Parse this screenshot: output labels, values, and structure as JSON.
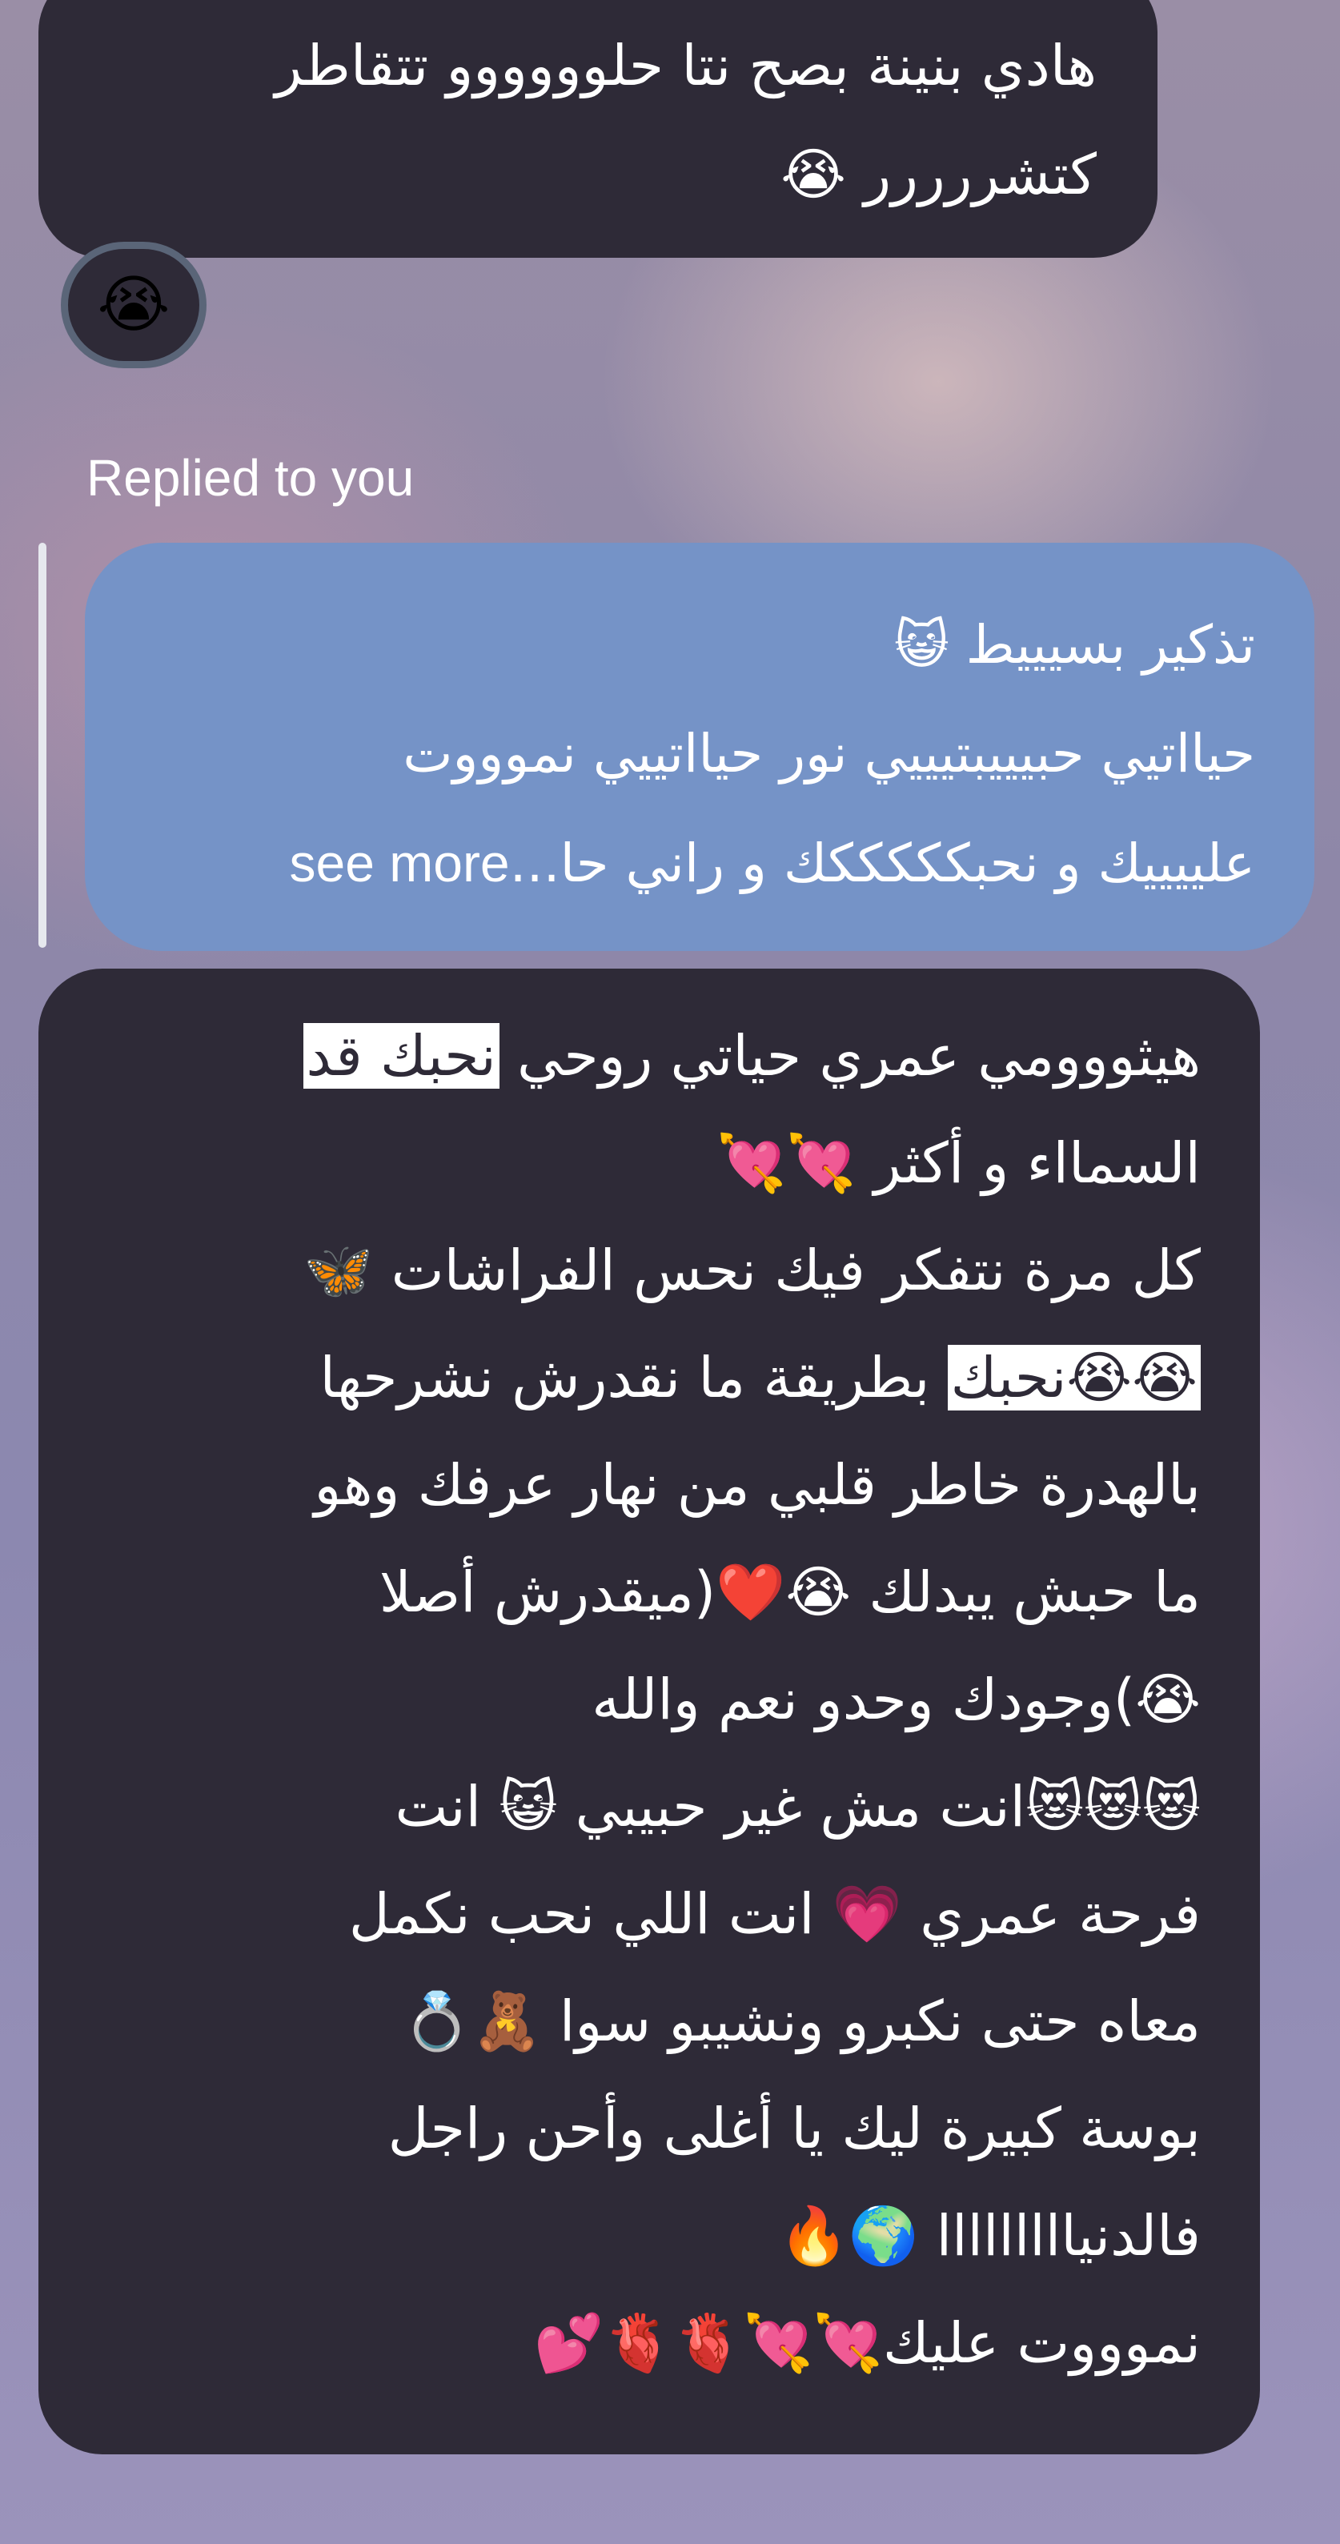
{
  "chat": {
    "message1": {
      "lines": [
        "هادي بنينة بصح نتا حلوووووو تتقاطر",
        "كتشررررر 😭"
      ]
    },
    "reaction_emoji": "😭",
    "reply_label": "Replied to you",
    "quoted_message": {
      "lines": [
        "تذكير بسيييط 😺",
        "حيااتيي حبيييبتيييي نور حيااتييي نموووت",
        "علييييك و نحبكككككك و راني حا..."
      ],
      "see_more": "see more"
    },
    "message2": {
      "line1_before": "هيثووومي عمري حياتي روحي ",
      "line1_highlight": "نحبك قد",
      "lines_mid": [
        "السمااء و أكثر 💘💘",
        "كل مرة نتفكر فيك نحس الفراشات 🦋"
      ],
      "line4_highlight": "😭😭نحبك",
      "line4_after": " بطريقة ما نقدرش نشرحها",
      "lines_rest": [
        "بالهدرة  خاطر قلبي من نهار عرفك وهو",
        "ما حبش يبدلك 😭❤️(ميقدرش أصلا",
        "😭)وجودك وحدو نعم والله",
        "😻😻😻انت مش غير حبيبي 😺 انت",
        "فرحة عمري 💗 انت اللي نحب نكمل",
        "معاه حتى نكبرو ونشيبو سوا 🧸💍",
        "بوسة كبيرة ليك يا أغلى وأحن راجل",
        "فالدنيااااااااا 🌍🔥",
        "نموووت عليك💘💘🫀🫀💕"
      ]
    }
  },
  "colors": {
    "bubble_dark": "#2e2a37",
    "bubble_quoted": "#7593c7",
    "reaction_ring": "#5a6578",
    "highlight": "#ffffff"
  }
}
